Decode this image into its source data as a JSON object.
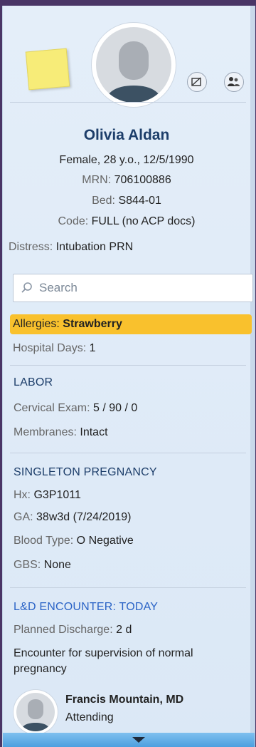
{
  "patient": {
    "name": "Olivia Aldan",
    "demographics": "Female, 28 y.o., 12/5/1990",
    "mrn_label": "MRN:",
    "mrn": "706100886",
    "bed_label": "Bed:",
    "bed": "S844-01",
    "code_label": "Code:",
    "code": "FULL (no ACP docs)",
    "distress_label": "Distress:",
    "distress": "Intubation PRN"
  },
  "search": {
    "placeholder": "Search"
  },
  "allergies": {
    "label": "Allergies:",
    "value": "Strawberry"
  },
  "hospital_days": {
    "label": "Hospital Days:",
    "value": "1"
  },
  "labor": {
    "title": "LABOR",
    "cervical_label": "Cervical Exam:",
    "cervical": "5 / 90 / 0",
    "membranes_label": "Membranes:",
    "membranes": "Intact"
  },
  "pregnancy": {
    "title": "SINGLETON PREGNANCY",
    "hx_label": "Hx:",
    "hx": "G3P1011",
    "ga_label": "GA:",
    "ga": "38w3d (7/24/2019)",
    "blood_label": "Blood Type:",
    "blood": "O Negative",
    "gbs_label": "GBS:",
    "gbs": "None"
  },
  "encounter": {
    "title": "L&D ENCOUNTER: TODAY",
    "discharge_label": "Planned Discharge:",
    "discharge": "2 d",
    "reason_line1": "Encounter for supervision of normal",
    "reason_line2": "pregnancy"
  },
  "attending": {
    "name": "Francis Mountain, MD",
    "role": "Attending"
  },
  "colors": {
    "accent": "#1d3e6a",
    "allergy_highlight": "#f9c12d",
    "section_link": "#2a63c6"
  }
}
